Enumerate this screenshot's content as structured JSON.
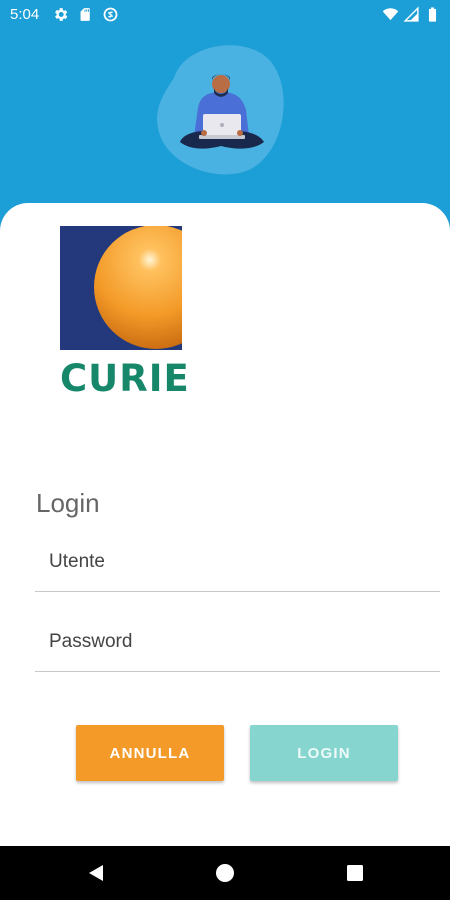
{
  "status_bar": {
    "time": "5:04",
    "left_icons": [
      "gear-icon",
      "sd-card-icon",
      "no-sync-icon"
    ],
    "right_icons": [
      "wifi-icon",
      "signal-icon",
      "battery-icon"
    ]
  },
  "brand": {
    "logo_text": "CURIE",
    "logo_text_color": "#17876a",
    "logo_bg_color": "#23397c",
    "sphere_color": "#f39a28"
  },
  "header": {
    "background_color": "#1c9ed6",
    "illustration": "person-with-laptop-illustration"
  },
  "form": {
    "heading": "Login",
    "user_field": {
      "placeholder": "Utente",
      "value": ""
    },
    "password_field": {
      "placeholder": "Password",
      "value": ""
    }
  },
  "buttons": {
    "cancel": {
      "label": "ANNULLA",
      "color": "#f39a28"
    },
    "login": {
      "label": "LOGIN",
      "color": "#86d6cf"
    }
  },
  "nav_bar": {
    "buttons": [
      "back-icon",
      "home-icon",
      "recents-icon"
    ]
  }
}
